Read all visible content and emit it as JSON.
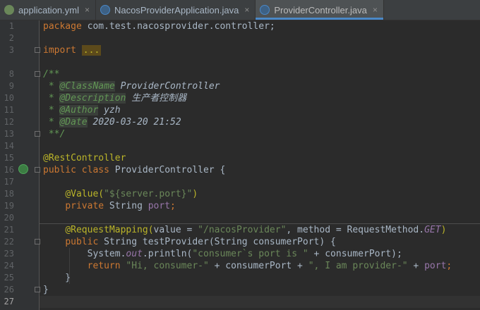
{
  "tabs": [
    {
      "label": "application.yml",
      "icon": "yml-file-icon",
      "active": false
    },
    {
      "label": "NacosProviderApplication.java",
      "icon": "java-class-icon",
      "active": false
    },
    {
      "label": "ProviderController.java",
      "icon": "java-class-icon",
      "active": true
    }
  ],
  "tab_close_glyph": "×",
  "line_numbers": [
    "1",
    "2",
    "3",
    "8",
    "9",
    "10",
    "11",
    "12",
    "13",
    "14",
    "15",
    "16",
    "17",
    "18",
    "19",
    "20",
    "21",
    "22",
    "23",
    "24",
    "25",
    "26",
    "27"
  ],
  "code": {
    "l1_kw": "package",
    "l1_rest": " com.test.nacosprovider.controller;",
    "l3_kw": "import",
    "l3_fold": "...",
    "l8": "/**",
    "l9_star": " * ",
    "l9_tag": "@ClassName",
    "l9_val": " ProviderController",
    "l10_star": " * ",
    "l10_tag": "@Description",
    "l10_val": " 生产者控制器",
    "l11_star": " * ",
    "l11_tag": "@Author",
    "l11_val": " yzh",
    "l12_star": " * ",
    "l12_tag": "@Date",
    "l12_val": " 2020-03-20 21:52",
    "l13": " **/",
    "l15_ann": "@RestController",
    "l16_kw": "public class",
    "l16_rest": " ProviderController {",
    "l18_ind": "    ",
    "l18_ann": "@Value(",
    "l18_str": "\"${server.port}\"",
    "l18_end": ")",
    "l19_ind": "    ",
    "l19_kw": "private",
    "l19_type": " String ",
    "l19_field": "port",
    "l19_semi": ";",
    "l21_ind": "    ",
    "l21_ann": "@RequestMapping(",
    "l21_a": "value = ",
    "l21_str": "\"/nacosProvider\"",
    "l21_b": ", method = ",
    "l21_c": "RequestMethod.",
    "l21_d": "GET",
    "l21_e": ")",
    "l22_ind": "    ",
    "l22_kw": "public",
    "l22_rest": " String testProvider(String consumerPort) {",
    "l23_ind": "        ",
    "l23_a": "System.",
    "l23_out": "out",
    "l23_b": ".println(",
    "l23_str": "\"consumer`s port is \"",
    "l23_c": " + consumerPort);",
    "l24_ind": "        ",
    "l24_kw": "return",
    "l24_s1": " \"Hi, consumer-\"",
    "l24_a": " + consumerPort + ",
    "l24_s2": "\", I am provider-\"",
    "l24_b": " + ",
    "l24_field": "port",
    "l24_semi": ";",
    "l25": "    }",
    "l26": "}"
  }
}
